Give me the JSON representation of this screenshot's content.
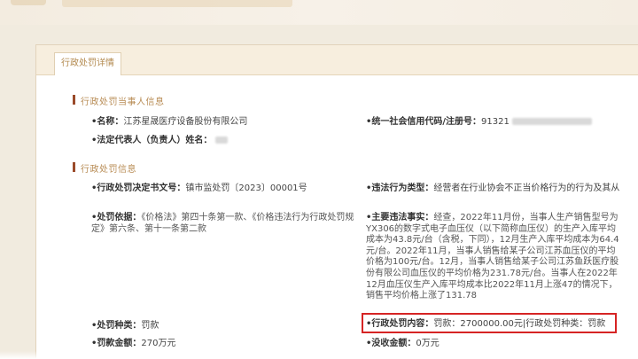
{
  "panel": {
    "tab_label": "行政处罚详情"
  },
  "section1": {
    "title": "行政处罚当事人信息",
    "party_label": "•名称：",
    "party_value": "江苏星晟医疗设备股份有限公司",
    "credit_label": "•统一社会信用代码/注册号：",
    "credit_value": "91321",
    "rep_label": "•法定代表人（负责人）姓名："
  },
  "section2": {
    "title": "行政处罚信息",
    "doc_no_label": "•行政处罚决定书文号：",
    "doc_no_value": "镇市监处罚〔2023〕00001号",
    "violation_label": "•违法行为类型：",
    "violation_value": "经营者在行业协会不正当价格行为的行为及其从",
    "basis_label": "•处罚依据：",
    "basis_value": "《价格法》第四十条第一款、《价格违法行为行政处罚规定》第六条、第十一条第二款",
    "facts_label": "•主要违法事实：",
    "facts_value": "经查，2022年11月份，当事人生产销售型号为YX306的数字式电子血压仪（以下简称血压仪）的生产入库平均成本为43.8元/台（含税，下同），12月生产入库平均成本为64.4元/台。2022年11月，当事人销售给某子公司江苏血压仪的平均价格为100元/台。12月，当事人销售给某子公司江苏鱼跃医疗股份有限公司血压仪的平均价格为231.78元/台。当事人在2022年12月血压仪生产入库平均成本比2022年11月上涨47的情况下，销售平均价格上涨了131.78",
    "penalty_type_label": "•处罚种类：",
    "penalty_type_value": "罚款",
    "content_label": "•行政处罚内容：",
    "content_value": "罚款：2700000.00元|行政处罚种类：罚款",
    "fine_label": "•罚款金额：",
    "fine_value": "270万元",
    "confiscated_label": "•没收金额：",
    "confiscated_value": "0万元"
  }
}
